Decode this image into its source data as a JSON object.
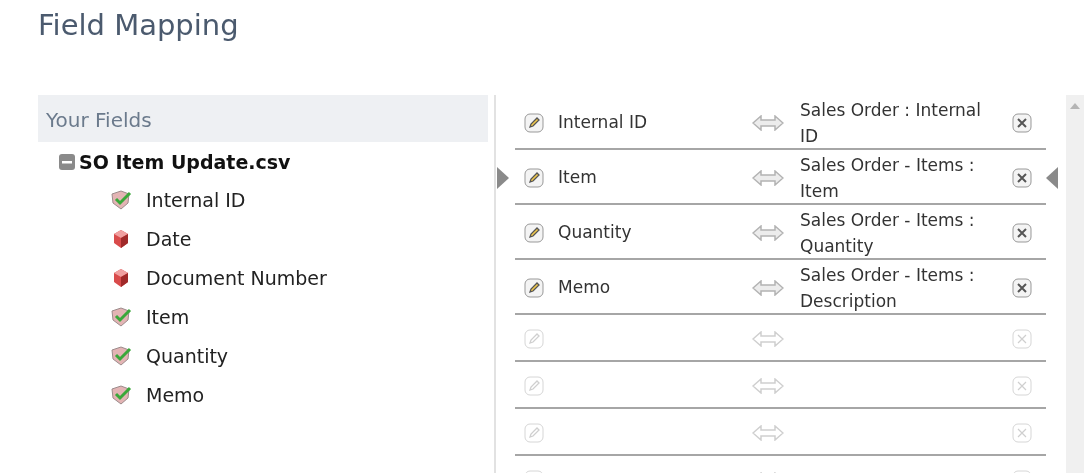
{
  "page_title": "Field Mapping",
  "your_fields": {
    "header": "Your Fields",
    "tree": [
      {
        "label": "SO Item Update.csv",
        "expanded": true,
        "children": [
          {
            "label": "Internal ID",
            "mapped": true
          },
          {
            "label": "Date",
            "mapped": false
          },
          {
            "label": "Document Number",
            "mapped": false
          },
          {
            "label": "Item",
            "mapped": true
          },
          {
            "label": "Quantity",
            "mapped": true
          },
          {
            "label": "Memo",
            "mapped": true
          }
        ]
      }
    ]
  },
  "mappings": [
    {
      "kind": "mapped",
      "source": "Internal ID",
      "target": "Sales Order : Internal ID",
      "selected": false
    },
    {
      "kind": "mapped",
      "source": "Item",
      "target": "Sales Order - Items : Item",
      "selected": true
    },
    {
      "kind": "mapped",
      "source": "Quantity",
      "target": "Sales Order - Items : Quantity",
      "selected": false
    },
    {
      "kind": "mapped",
      "source": "Memo",
      "target": "Sales Order - Items : Description",
      "selected": false
    },
    {
      "kind": "empty",
      "selected": false
    },
    {
      "kind": "empty",
      "selected": false
    },
    {
      "kind": "empty",
      "selected": false
    },
    {
      "kind": "empty",
      "selected": false
    }
  ]
}
